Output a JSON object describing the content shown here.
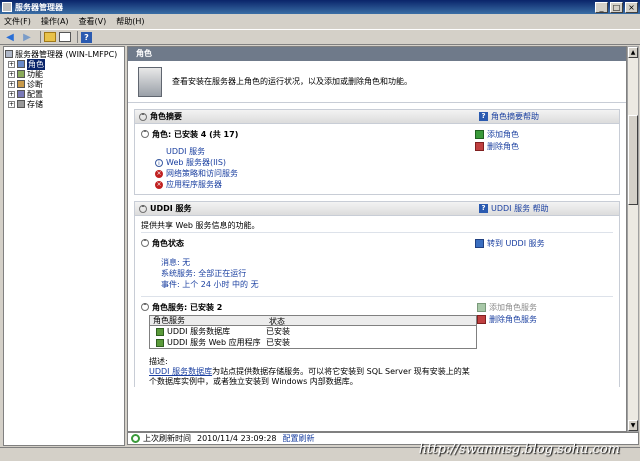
{
  "window": {
    "title": "服务器管理器"
  },
  "menu": [
    "文件(F)",
    "操作(A)",
    "查看(V)",
    "帮助(H)"
  ],
  "tree": {
    "root": "服务器管理器 (WIN-LMFPC)",
    "items": [
      "角色",
      "功能",
      "诊断",
      "配置",
      "存储"
    ]
  },
  "content": {
    "header": "角色",
    "intro": "查看安装在服务器上角色的运行状况，以及添加或删除角色和功能。",
    "summary": {
      "title": "角色摘要",
      "help": "角色摘要帮助",
      "roles_head": "角色: 已安装 4 (共 17)",
      "roles": [
        {
          "name": "UDDI 服务",
          "status": "none"
        },
        {
          "name": "Web 服务器(IIS)",
          "status": "info"
        },
        {
          "name": "网络策略和访问服务",
          "status": "err"
        },
        {
          "name": "应用程序服务器",
          "status": "err"
        }
      ],
      "actions": [
        "添加角色",
        "删除角色"
      ]
    },
    "uddi": {
      "title": "UDDI 服务",
      "help": "UDDI 服务 帮助",
      "desc": "提供共享 Web 服务信息的功能。",
      "status_head": "角色状态",
      "goto": "转到 UDDI 服务",
      "status_lines": [
        "消息: 无",
        "系统服务: 全部正在运行",
        "事件: 上个 24 小时 中的 无"
      ],
      "services_head": "角色服务: 已安装 2",
      "service_actions": [
        "添加角色服务",
        "删除角色服务"
      ],
      "table": {
        "headers": [
          "角色服务",
          "状态"
        ],
        "rows": [
          {
            "name": "UDDI 服务数据库",
            "state": "已安装"
          },
          {
            "name": "UDDI 服务 Web 应用程序",
            "state": "已安装"
          }
        ]
      },
      "desc_label": "描述:",
      "more_link": "UDDI 服务数据库",
      "more_text": "为站点提供数据存储服务。可以将它安装到 SQL Server 现有安装上的某个数据库实例中，或者独立安装到 Windows 内部数据库。"
    }
  },
  "status": {
    "label": "上次刷新时间",
    "time": "2010/11/4 23:09:28",
    "refresh": "配置刷新"
  },
  "watermark": "http://swanmsg.blog.sohu.com"
}
